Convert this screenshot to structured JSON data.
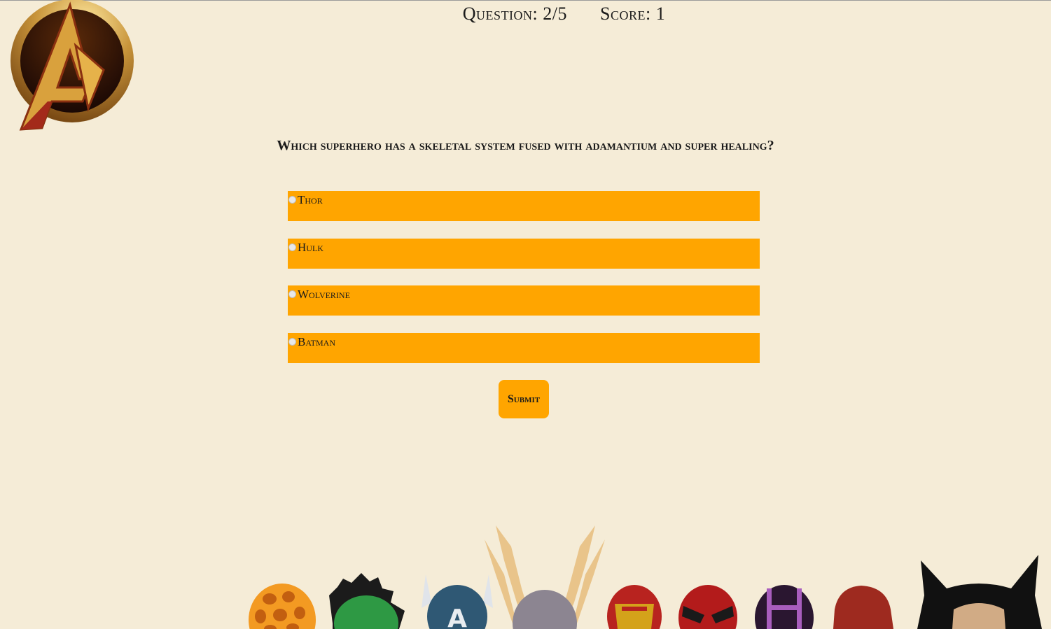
{
  "header": {
    "question_label": "Question: 2/5",
    "score_label": "Score: 1"
  },
  "logo": {
    "icon": "avengers-logo-icon"
  },
  "quiz": {
    "question": "Which superhero has a skeletal system fused with adamantium and super healing?",
    "options": [
      {
        "label": "Thor"
      },
      {
        "label": "Hulk"
      },
      {
        "label": "Wolverine"
      },
      {
        "label": "Batman"
      }
    ],
    "submit_label": "Submit"
  },
  "colors": {
    "background": "#f5ecd7",
    "accent": "#ffa500"
  },
  "footer": {
    "heroes": [
      "thing-head-icon",
      "hulk-head-icon",
      "captain-america-head-icon",
      "thor-head-icon",
      "iron-man-head-icon",
      "spider-man-head-icon",
      "hawkeye-head-icon",
      "black-widow-head-icon",
      "wolverine-head-icon"
    ]
  }
}
